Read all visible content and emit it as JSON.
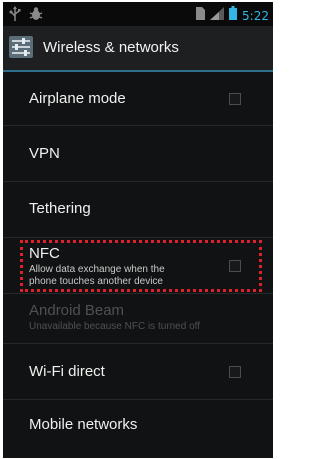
{
  "status_bar": {
    "time": "5:22",
    "icons": [
      "usb-icon",
      "debug-icon",
      "sim-icon",
      "signal-icon",
      "battery-icon"
    ]
  },
  "action_bar": {
    "title": "Wireless & networks",
    "icon": "settings-app-icon"
  },
  "settings": {
    "items": [
      {
        "title": "Airplane mode",
        "summary": "",
        "has_checkbox": true,
        "checked": false,
        "enabled": true
      },
      {
        "title": "VPN",
        "summary": "",
        "has_checkbox": false,
        "enabled": true
      },
      {
        "title": "Tethering",
        "summary": "",
        "has_checkbox": false,
        "enabled": true
      },
      {
        "title": "NFC",
        "summary": "Allow data exchange when the phone touches another device",
        "summary_line1": "Allow data exchange when the",
        "summary_line2": "phone touches another device",
        "has_checkbox": true,
        "checked": false,
        "enabled": true,
        "highlighted": true
      },
      {
        "title": "Android Beam",
        "summary": "Unavailable because NFC is turned off",
        "has_checkbox": false,
        "enabled": false
      },
      {
        "title": "Wi-Fi direct",
        "summary": "",
        "has_checkbox": true,
        "checked": false,
        "enabled": true
      },
      {
        "title": "Mobile networks",
        "summary": "",
        "has_checkbox": false,
        "enabled": true
      }
    ]
  },
  "colors": {
    "accent": "#33b5e5",
    "highlight_outline": "#e0202a",
    "background": "#111213"
  }
}
